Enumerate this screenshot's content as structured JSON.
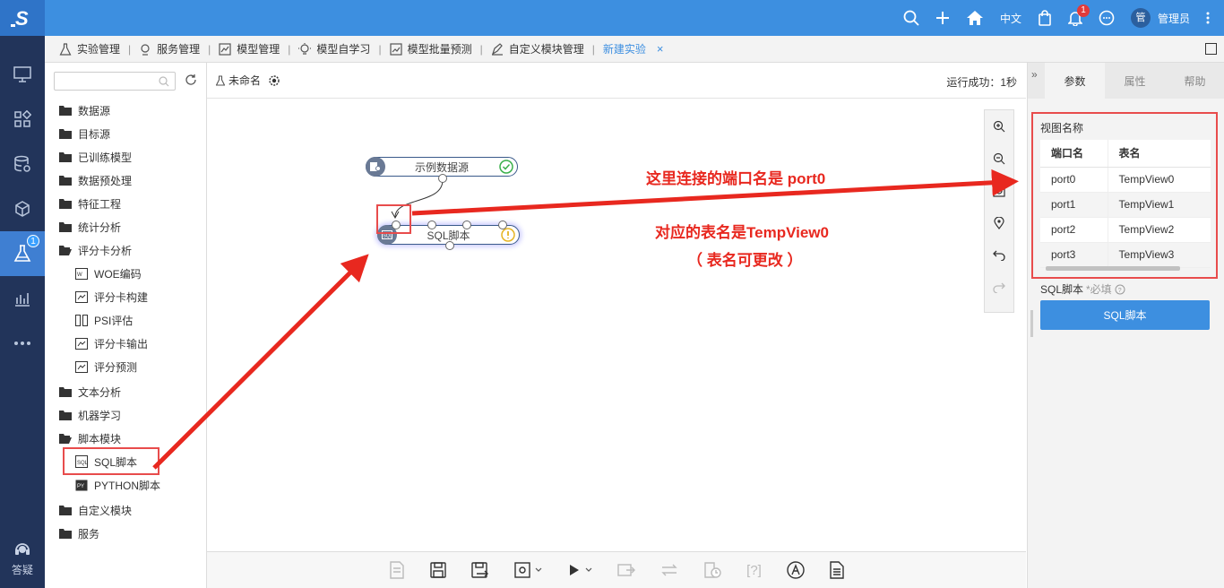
{
  "app": {
    "logo_letter": "S"
  },
  "rail": {
    "badge": "1",
    "help_label": "答疑"
  },
  "topbar": {
    "lang": "中文",
    "notification_count": "1",
    "avatar_char": "管",
    "username": "管理员"
  },
  "tabs": [
    {
      "label": "实验管理"
    },
    {
      "label": "服务管理"
    },
    {
      "label": "模型管理"
    },
    {
      "label": "模型自学习"
    },
    {
      "label": "模型批量预测"
    },
    {
      "label": "自定义模块管理"
    },
    {
      "label": "新建实验"
    }
  ],
  "tree": {
    "search_placeholder": "",
    "items": [
      {
        "label": "数据源"
      },
      {
        "label": "目标源"
      },
      {
        "label": "已训练模型"
      },
      {
        "label": "数据预处理"
      },
      {
        "label": "特征工程"
      },
      {
        "label": "统计分析"
      },
      {
        "label": "评分卡分析"
      },
      {
        "label": "WOE编码"
      },
      {
        "label": "评分卡构建"
      },
      {
        "label": "PSI评估"
      },
      {
        "label": "评分卡输出"
      },
      {
        "label": "评分预测"
      },
      {
        "label": "文本分析"
      },
      {
        "label": "机器学习"
      },
      {
        "label": "脚本模块"
      },
      {
        "label": "SQL脚本"
      },
      {
        "label": "PYTHON脚本"
      },
      {
        "label": "自定义模块"
      },
      {
        "label": "服务"
      }
    ]
  },
  "canvas": {
    "experiment_name": "未命名",
    "status": "运行成功：1秒",
    "node_source": "示例数据源",
    "node_sql": "SQL脚本",
    "annotation_1": "这里连接的端口名是 port0",
    "annotation_2": "对应的表名是TempView0",
    "annotation_3": "（ 表名可更改 ）",
    "bottom_help": "[?]"
  },
  "panel": {
    "tabs": [
      {
        "label": "参数"
      },
      {
        "label": "属性"
      },
      {
        "label": "帮助"
      }
    ],
    "view_name_label": "视图名称",
    "table_headers": [
      "端口名",
      "表名"
    ],
    "rows": [
      [
        "port0",
        "TempView0"
      ],
      [
        "port1",
        "TempView1"
      ],
      [
        "port2",
        "TempView2"
      ],
      [
        "port3",
        "TempView3"
      ]
    ],
    "sql_label": "SQL脚本",
    "required": "*必填",
    "sql_button": "SQL脚本"
  },
  "colors": {
    "topbar": "#3d8fe0",
    "rail": "#22345a",
    "annotation": "#e8281f"
  }
}
